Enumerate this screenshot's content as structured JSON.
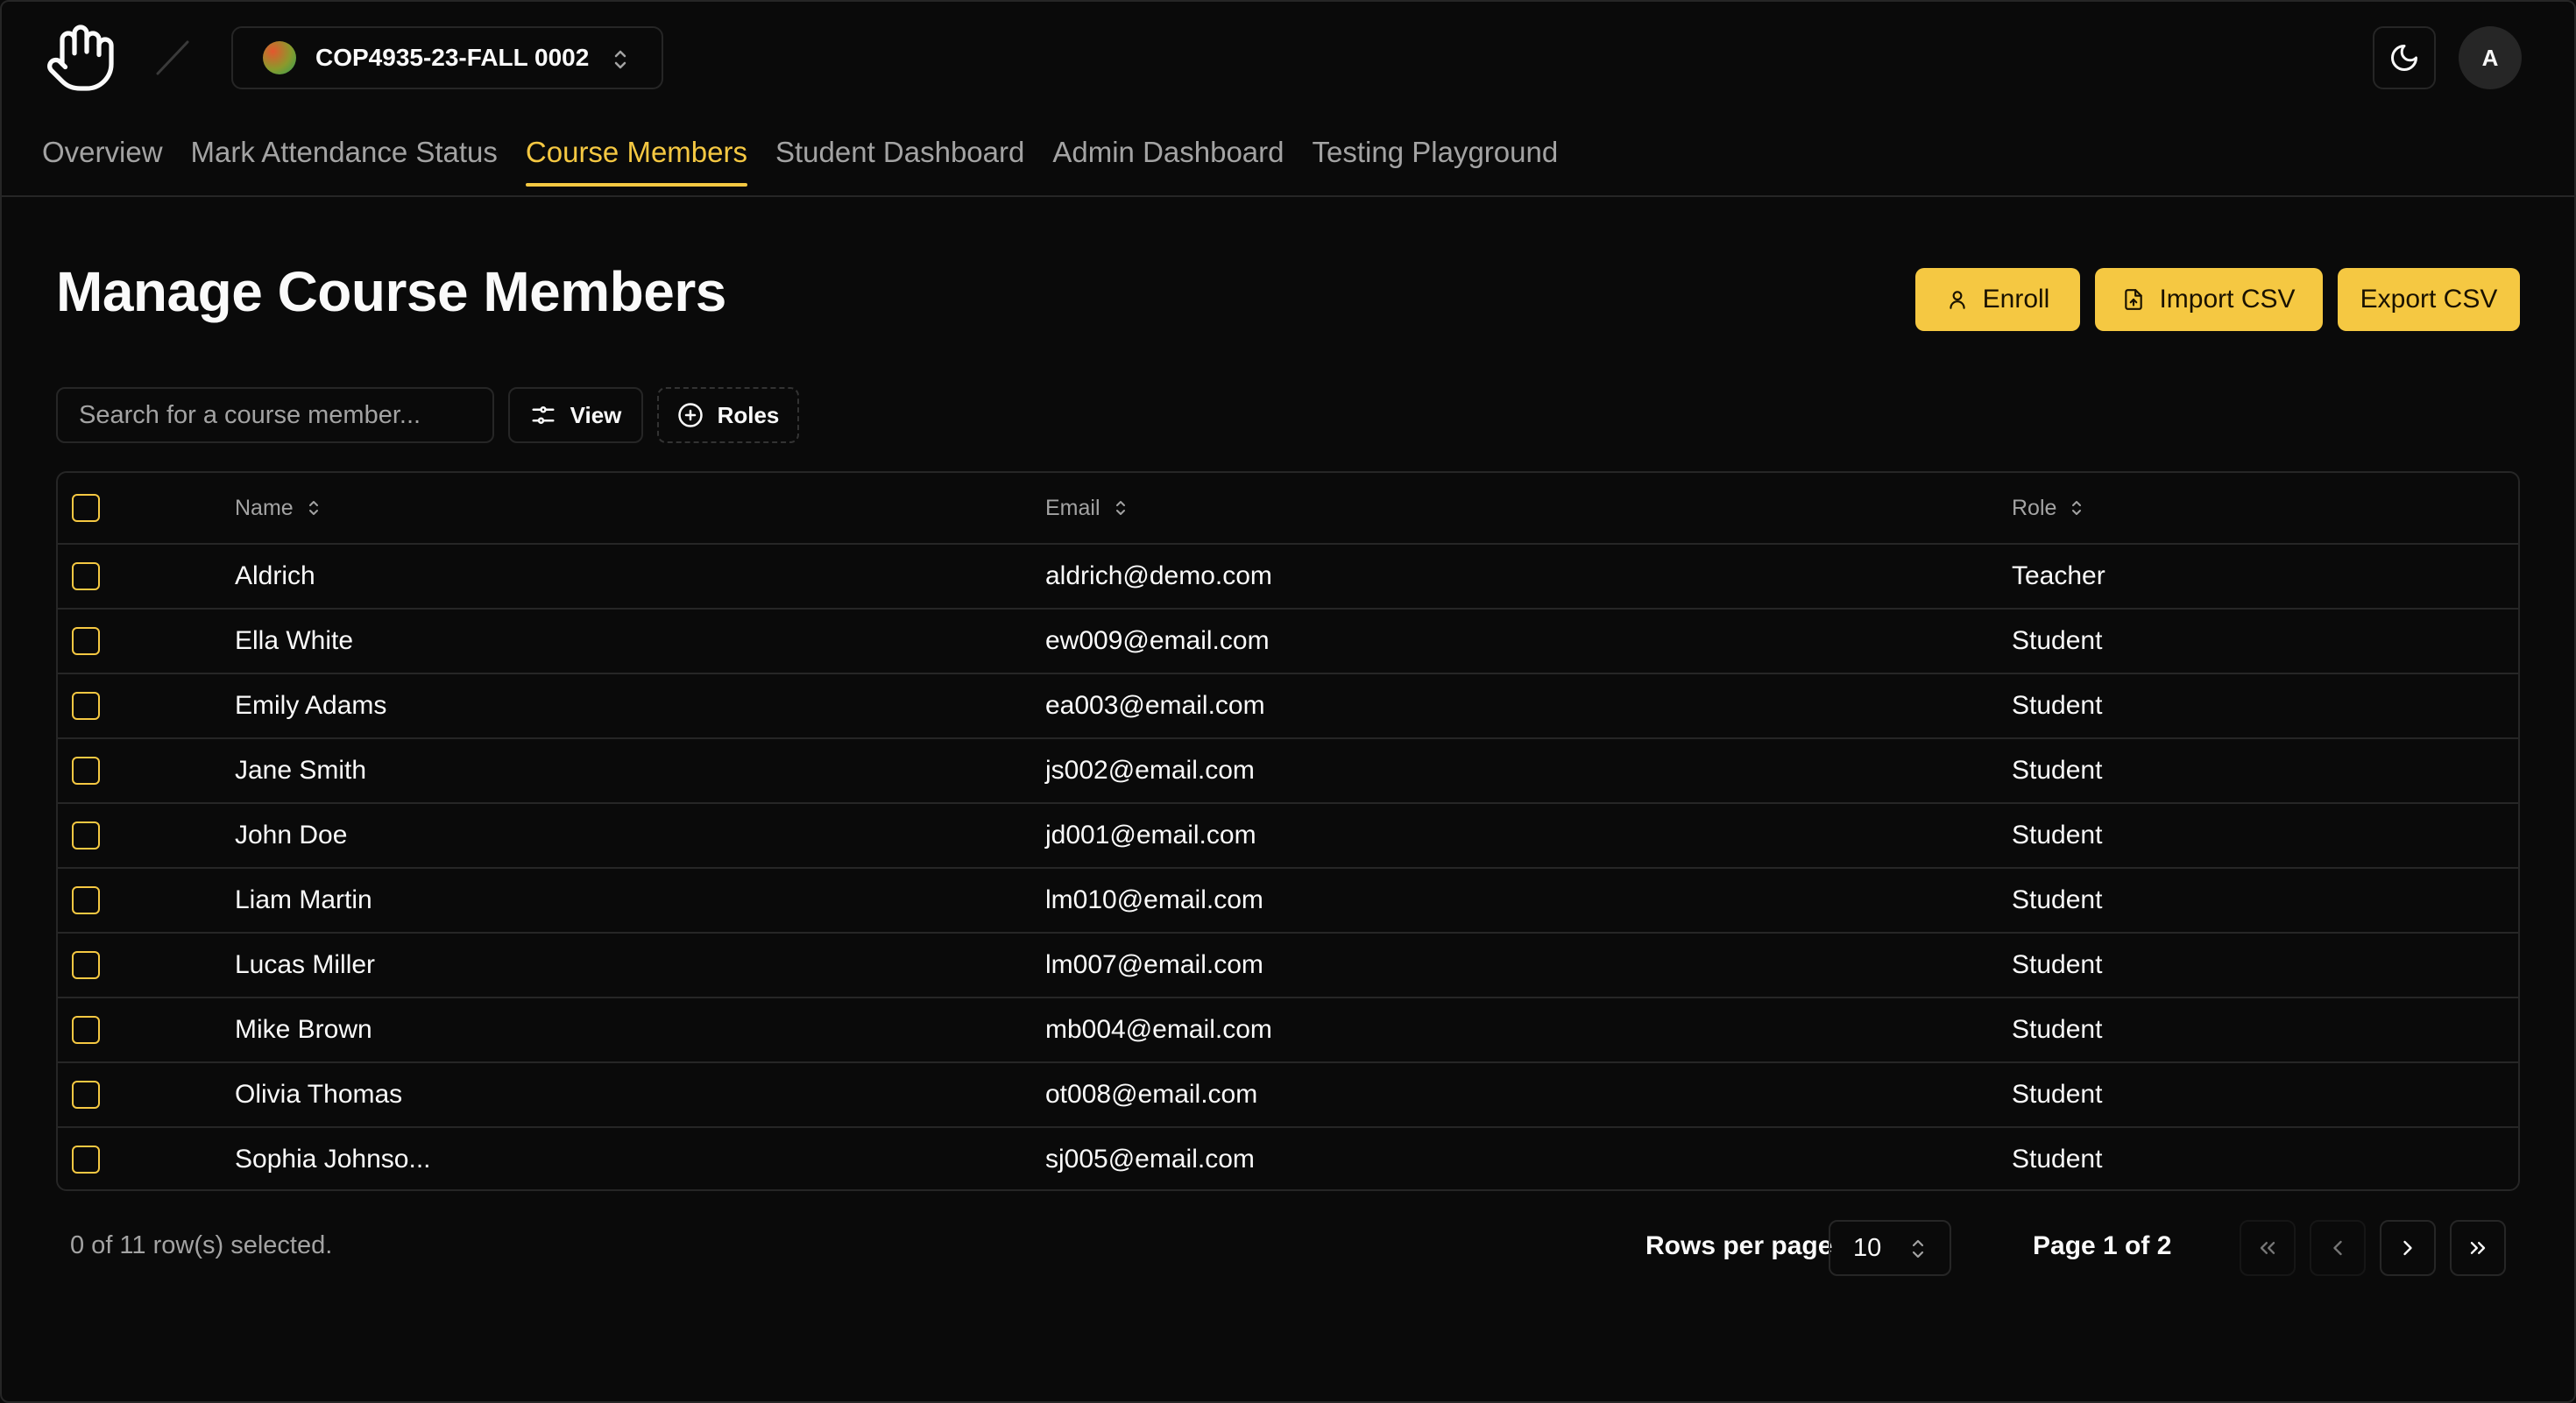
{
  "header": {
    "course": {
      "name": "COP4935-23-FALL 0002"
    },
    "user_initial": "A",
    "nav_tabs": [
      {
        "label": "Overview",
        "active": false
      },
      {
        "label": "Mark Attendance Status",
        "active": false
      },
      {
        "label": "Course Members",
        "active": true
      },
      {
        "label": "Student Dashboard",
        "active": false
      },
      {
        "label": "Admin Dashboard",
        "active": false
      },
      {
        "label": "Testing Playground",
        "active": false
      }
    ]
  },
  "main": {
    "title": "Manage Course Members",
    "actions": {
      "enroll_label": "Enroll",
      "import_label": "Import CSV",
      "export_label": "Export CSV"
    },
    "toolbar": {
      "search_placeholder": "Search for a course member...",
      "view_label": "View",
      "roles_label": "Roles"
    },
    "table": {
      "columns": [
        "Name",
        "Email",
        "Role"
      ],
      "rows": [
        {
          "name": "Aldrich",
          "email": "aldrich@demo.com",
          "role": "Teacher"
        },
        {
          "name": "Ella White",
          "email": "ew009@email.com",
          "role": "Student"
        },
        {
          "name": "Emily Adams",
          "email": "ea003@email.com",
          "role": "Student"
        },
        {
          "name": "Jane Smith",
          "email": "js002@email.com",
          "role": "Student"
        },
        {
          "name": "John Doe",
          "email": "jd001@email.com",
          "role": "Student"
        },
        {
          "name": "Liam Martin",
          "email": "lm010@email.com",
          "role": "Student"
        },
        {
          "name": "Lucas Miller",
          "email": "lm007@email.com",
          "role": "Student"
        },
        {
          "name": "Mike Brown",
          "email": "mb004@email.com",
          "role": "Student"
        },
        {
          "name": "Olivia Thomas",
          "email": "ot008@email.com",
          "role": "Student"
        },
        {
          "name": "Sophia Johnso...",
          "email": "sj005@email.com",
          "role": "Student"
        }
      ]
    },
    "footer": {
      "selected_text": "0 of 11 row(s) selected.",
      "rows_per_page_label": "Rows per page",
      "rows_per_page_value": "10",
      "page_label": "Page 1 of 2"
    }
  },
  "colors": {
    "background": "#0a0a0a",
    "accent": "#f5c842",
    "border": "#262626",
    "muted_text": "#a3a3a3"
  },
  "icons": [
    "wave-hand-icon",
    "slash-separator-icon",
    "chevron-up-down-icon",
    "moon-icon",
    "user-icon",
    "file-upload-icon",
    "sliders-icon",
    "plus-circle-icon",
    "sort-icon",
    "chevrons-left-icon",
    "chevron-left-icon",
    "chevron-right-icon",
    "chevrons-right-icon"
  ]
}
